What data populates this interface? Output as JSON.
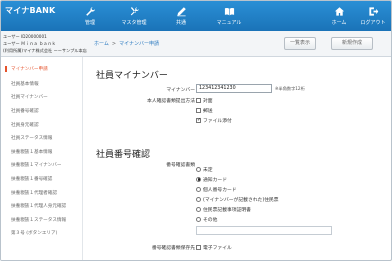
{
  "app": {
    "brand": "マイナBANK"
  },
  "nav": [
    {
      "label": "管理",
      "icon": "wrench-icon"
    },
    {
      "label": "マスタ管理",
      "icon": "tools-icon"
    },
    {
      "label": "共通",
      "icon": "pen-icon"
    },
    {
      "label": "マニュアル",
      "icon": "book-icon"
    },
    {
      "label": "ホーム",
      "icon": "home-icon"
    },
    {
      "label": "ログアウト",
      "icon": "logout-icon"
    }
  ],
  "user": {
    "line1": "ユーザー ID20000001",
    "line2": "ユーザー Ｍｉｎａ ｂａｎｋ",
    "line3": "(利用所属)マイナ株式会社 ーーサンプル本店ーー"
  },
  "breadcrumb": {
    "home": "ホーム",
    "separator": ">",
    "current": "マイナンバー申請"
  },
  "toolbar": {
    "list_label": "一覧表示",
    "new_label": "新規作成"
  },
  "sidebar": {
    "items": [
      {
        "label": "マイナンバー申請",
        "active": true
      },
      {
        "label": "社員基本情報",
        "active": false
      },
      {
        "label": "社員マイナンバー",
        "active": false
      },
      {
        "label": "社員番号確認",
        "active": false
      },
      {
        "label": "社員身元確認",
        "active": false
      },
      {
        "label": "社員ステータス情報",
        "active": false
      },
      {
        "label": "扶養親族１基本情報",
        "active": false
      },
      {
        "label": "扶養親族１マイナンバー",
        "active": false
      },
      {
        "label": "扶養親族１番号確認",
        "active": false
      },
      {
        "label": "扶養親族１代理者確認",
        "active": false
      },
      {
        "label": "扶養親族１代理人身元確認",
        "active": false
      },
      {
        "label": "扶養親族１ステータス情報",
        "active": false
      },
      {
        "label": "第３号 (ボタンエリア)",
        "active": false
      }
    ]
  },
  "section1": {
    "title": "社員マイナンバー",
    "mynumber_label": "マイナンバー",
    "mynumber_value": "123412341230",
    "mynumber_note": "※半角数字12桁",
    "method_label": "本人確認書類提出方法",
    "methods": [
      {
        "label": "対面",
        "checked": false
      },
      {
        "label": "郵送",
        "checked": false
      },
      {
        "label": "ファイル添付",
        "checked": true
      }
    ]
  },
  "section2": {
    "title": "社員番号確認",
    "type_label": "番号確認書類",
    "options": [
      {
        "label": "未定",
        "selected": false
      },
      {
        "label": "通知カード",
        "selected": true
      },
      {
        "label": "個人番号カード",
        "selected": false
      },
      {
        "label": "(マイナンバーが記載された)住民票",
        "selected": false
      },
      {
        "label": "住民票記載事項証明書",
        "selected": false
      },
      {
        "label": "その他",
        "selected": false
      }
    ],
    "storage_label": "番号確認書類保存先",
    "storage_option": {
      "label": "電子ファイル",
      "checked": false
    }
  },
  "colors": {
    "header": "#1f80c8",
    "accent": "#e5522b",
    "link": "#2a79c0"
  }
}
